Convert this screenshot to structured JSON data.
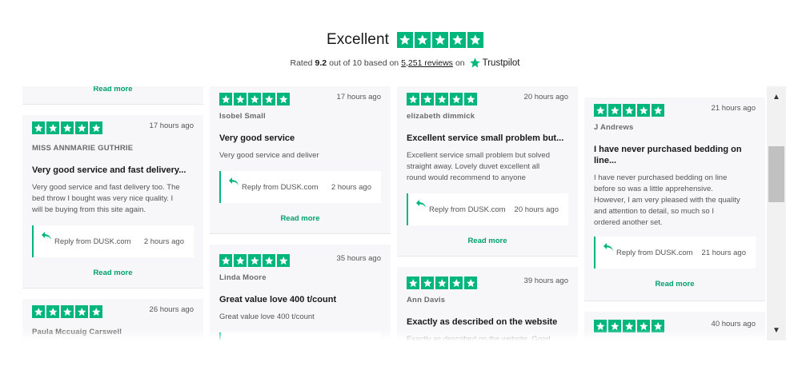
{
  "header": {
    "title": "Excellent",
    "rated_prefix": "Rated",
    "score": "9.2",
    "score_suffix": "out of 10 based on",
    "reviews_count": "5,251 reviews",
    "on": "on",
    "brand": "Trustpilot",
    "stars": 5
  },
  "colors": {
    "star_green": "#00b67a",
    "read_more": "#00a06b"
  },
  "columns": [
    {
      "cards": [
        {
          "read_more": "Read more"
        },
        {
          "stars": 5,
          "time": "17 hours ago",
          "author": "MISS ANNMARIE GUTHRIE",
          "title": "Very good service and fast delivery...",
          "body": [
            "Very good service and fast delivery too. The",
            "bed throw I bought was very nice quality. I",
            "will be buying from this site again."
          ],
          "reply_label": "Reply from DUSK.com",
          "reply_time": "2 hours ago",
          "read_more": "Read more"
        },
        {
          "stars": 5,
          "time": "26 hours ago",
          "author": "Paula Mccuaig Carswell"
        }
      ]
    },
    {
      "cards": [
        {
          "stars": 5,
          "time": "17 hours ago",
          "author": "Isobel Small",
          "title": "Very good service",
          "body": [
            "Very good service and deliver"
          ],
          "reply_label": "Reply from DUSK.com",
          "reply_time": "2 hours ago",
          "read_more": "Read more"
        },
        {
          "stars": 5,
          "time": "35 hours ago",
          "author": "Linda Moore",
          "title": "Great value love 400 t/count",
          "body": [
            "Great value love 400 t/count"
          ]
        }
      ]
    },
    {
      "cards": [
        {
          "stars": 5,
          "time": "20 hours ago",
          "author": "elizabeth dimmick",
          "title": "Excellent service small problem but...",
          "body": [
            "Excellent service small problem but solved",
            "straight away. Lovely duvet excellent all",
            "round would recommend to anyone"
          ],
          "reply_label": "Reply from DUSK.com",
          "reply_time": "20 hours ago",
          "read_more": "Read more"
        },
        {
          "stars": 5,
          "time": "39 hours ago",
          "author": "Ann Davis",
          "title": "Exactly as described on the website",
          "body": [
            "Exactly as described on the website. Good"
          ]
        }
      ]
    },
    {
      "cards": [
        {
          "stars": 5,
          "time": "21 hours ago",
          "author": "J Andrews",
          "title_lines": [
            "I have never purchased bedding on",
            "line..."
          ],
          "body": [
            "I have never purchased bedding on line",
            "before so was a little apprehensive.",
            "However, I am very pleased with the quality",
            "and attention to detail, so much so I",
            "ordered another set."
          ],
          "reply_label": "Reply from DUSK.com",
          "reply_time": "21 hours ago",
          "read_more": "Read more"
        },
        {
          "stars": 5,
          "time": "40 hours ago"
        }
      ]
    }
  ],
  "scrollbar": {
    "up_icon": "arrow-up-icon",
    "down_icon": "arrow-down-icon"
  }
}
